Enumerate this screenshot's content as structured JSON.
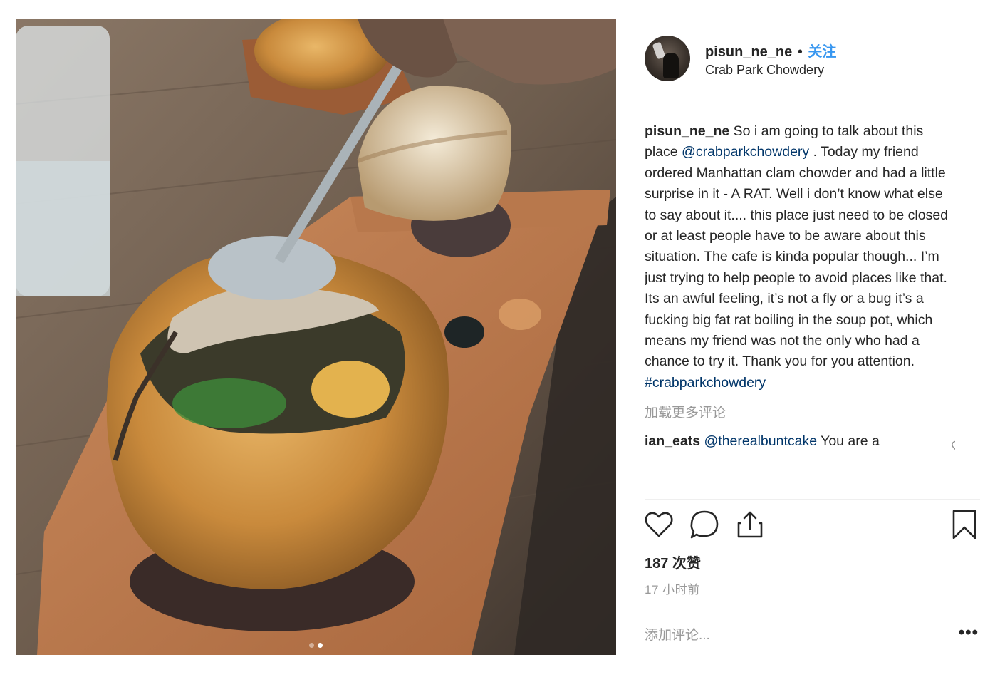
{
  "post": {
    "username": "pisun_ne_ne",
    "separator": "•",
    "follow_label": "关注",
    "location": "Crab Park Chowdery",
    "caption": {
      "username": "pisun_ne_ne",
      "text_1": " So i am going to talk about this place ",
      "mention": "@crabparkchowdery",
      "text_2": " . Today my friend ordered Manhattan clam chowder and had a little surprise in it - A RAT. Well i don’t know what else to say about it.... this place just need to be closed or at least people have to be aware about this situation. The cafe is kinda popular though... I’m just trying to help people to avoid places like that. Its an awful feeling, it’s not a fly or a bug it’s a fucking big fat rat boiling in the soup pot, which means my friend was not the only who had a chance to try it. Thank you for you attention. ",
      "hashtag": "#crabparkchowdery"
    },
    "load_more_label": "加载更多评论",
    "comment": {
      "username": "ian_eats",
      "mention": "@therealbuntcake",
      "text": " You are a"
    },
    "likes": "187 次赞",
    "time": "17 小时前",
    "add_comment_placeholder": "添加评论...",
    "more_options": "•••"
  },
  "carousel": {
    "count": 2,
    "active_index": 1
  },
  "icons": {
    "like": "heart-icon",
    "comment": "comment-bubble-icon",
    "share": "share-icon",
    "save": "bookmark-icon",
    "comment_like": "heart-icon",
    "more": "more-options-icon"
  },
  "colors": {
    "link": "#003569",
    "follow": "#3897f0",
    "muted": "#999999",
    "text": "#262626"
  }
}
